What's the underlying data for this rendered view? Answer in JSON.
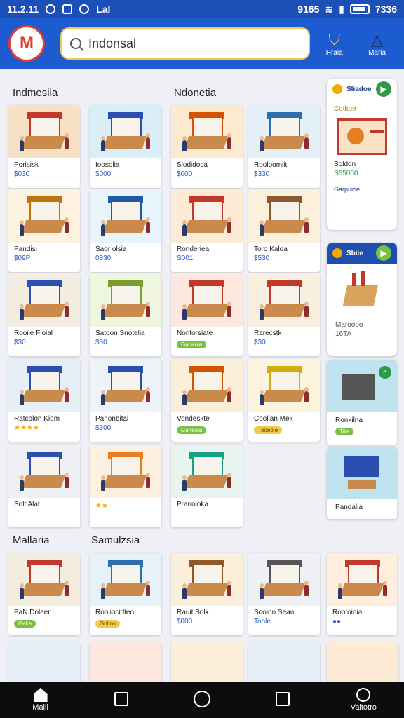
{
  "status": {
    "left_text": "11.2.11",
    "right_text": "7336",
    "mobile_label": "Lal",
    "notif_label": "9165"
  },
  "header": {
    "logo_text": "M",
    "search_value": "Indonsal",
    "btn1_label": "Hraia",
    "btn2_label": "Maria"
  },
  "sections": {
    "s1_left": "Indmesiia",
    "s1_mid": "Ndonetia",
    "s2_left": "Mallaria",
    "s2_mid": "Samulzsia"
  },
  "cards": [
    {
      "name": "Porisisk",
      "price": "$030"
    },
    {
      "name": "Ioosolia",
      "price": "$000"
    },
    {
      "name": "Slodidoca",
      "price": "$000"
    },
    {
      "name": "Rooloomiit",
      "price": "$330"
    },
    {
      "name": "Pandisi",
      "price": "$09P"
    },
    {
      "name": "Saor olsia",
      "price": "0330"
    },
    {
      "name": "Ronderiea",
      "price": "S001"
    },
    {
      "name": "Toro Kaloa",
      "price": "$530"
    },
    {
      "name": "Rooiie Fioial",
      "price": "$30"
    },
    {
      "name": "Satoon Snotelia",
      "price": "$30"
    },
    {
      "name": "Nonforsiate",
      "tag": "Ganeola"
    },
    {
      "name": "Rarecstk",
      "price": "$30"
    },
    {
      "name": "Ratcolon Kiom",
      "stars": "★★★★"
    },
    {
      "name": "Panonbital",
      "price": "$300"
    },
    {
      "name": "Vondeskte",
      "tag": "Ganeola"
    },
    {
      "name": "Coolian Mek",
      "tag": "Tooeole"
    },
    {
      "name": "Solt Alat",
      "price": ""
    },
    {
      "name": "",
      "stars": "★★"
    },
    {
      "name": "Pranoloka",
      "price": ""
    },
    {
      "name": "",
      "price": ""
    }
  ],
  "side_cards": {
    "top": {
      "head": "Sliadoe",
      "sub": "Cotltoe",
      "name": "Soldon",
      "price": "S65000",
      "footer": "Garpuioe"
    },
    "mid": {
      "head": "Sbiie",
      "name": "Maroooo",
      "price": "16TA"
    },
    "c3": {
      "name": "Ronkilna",
      "tag": "Tiiie"
    },
    "c4": {
      "name": "Pandalia"
    }
  },
  "bottom_cards": [
    {
      "name": "PaN Dolaer",
      "tag": "Gaka"
    },
    {
      "name": "Rooliocidteo",
      "tag": "Goltos"
    },
    {
      "name": "Rauit Solk",
      "price": "$000"
    },
    {
      "name": "Sooion Sean",
      "price": "Toole"
    },
    {
      "name": "Rootoinia",
      "price": "●●"
    }
  ],
  "nav": {
    "home_label": "Malli",
    "profile_label": "Valtotro"
  },
  "colors": {
    "brand_blue": "#1d5bd0",
    "accent_red": "#e43a2f",
    "accent_yellow": "#f2c94c"
  }
}
